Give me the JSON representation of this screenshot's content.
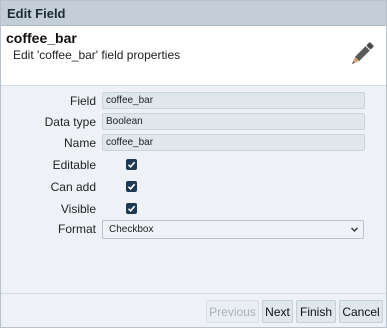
{
  "window": {
    "title": "Edit Field"
  },
  "header": {
    "title": "coffee_bar",
    "subtitle": "Edit 'coffee_bar' field properties",
    "icon": "pencil-icon"
  },
  "form": {
    "field": {
      "label": "Field",
      "value": "coffee_bar"
    },
    "data_type": {
      "label": "Data type",
      "value": "Boolean"
    },
    "name": {
      "label": "Name",
      "value": "coffee_bar"
    },
    "editable": {
      "label": "Editable",
      "checked": true
    },
    "can_add": {
      "label": "Can add",
      "checked": true
    },
    "visible": {
      "label": "Visible",
      "checked": true
    },
    "format": {
      "label": "Format",
      "value": "Checkbox"
    }
  },
  "buttons": {
    "previous": "Previous",
    "next": "Next",
    "finish": "Finish",
    "cancel": "Cancel"
  },
  "colors": {
    "titlebar": "#c3ced9",
    "checkbox": "#1d3a52",
    "panel": "#eef2f6"
  }
}
